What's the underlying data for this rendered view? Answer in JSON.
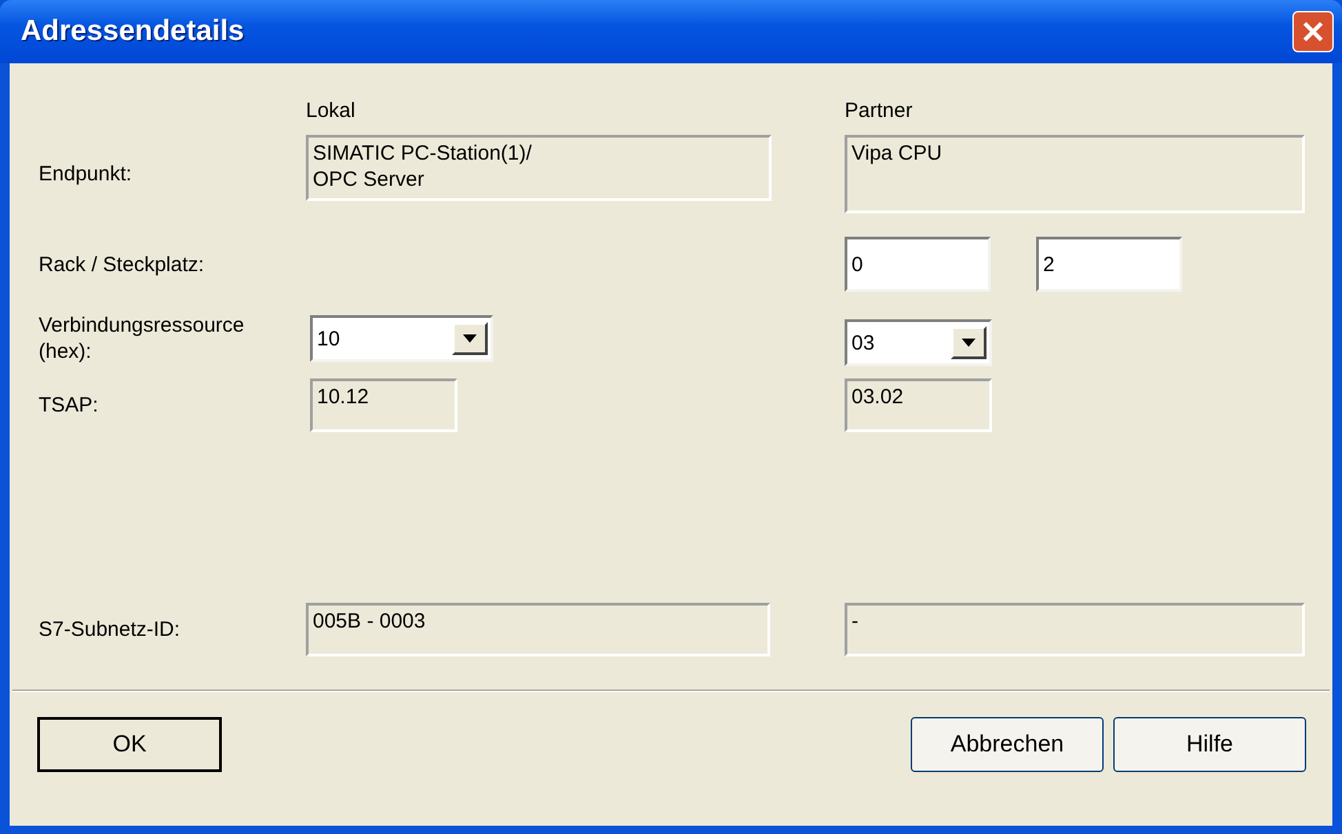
{
  "window": {
    "title": "Adressendetails"
  },
  "columns": [
    "Lokal",
    "Partner"
  ],
  "rows": [
    {
      "kind": "endpoint",
      "label": "Endpunkt:",
      "local": [
        {
          "kind": "readonly",
          "value": "SIMATIC PC-Station(1)/\nOPC Server"
        }
      ],
      "partner": [
        {
          "kind": "readonly",
          "value": "Vipa CPU"
        }
      ]
    },
    {
      "kind": "rack",
      "label": "Rack / Steckplatz:",
      "local": [],
      "partner": [
        {
          "kind": "input",
          "value": "0"
        },
        {
          "kind": "input",
          "value": "2"
        }
      ]
    },
    {
      "kind": "resource",
      "label": "Verbindungsressource (hex):",
      "local": [
        {
          "kind": "dropdown",
          "value": "10"
        }
      ],
      "partner": [
        {
          "kind": "dropdown",
          "value": "03"
        }
      ]
    },
    {
      "kind": "tsap",
      "label": "TSAP:",
      "local": [
        {
          "kind": "readonly",
          "value": "10.12"
        }
      ],
      "partner": [
        {
          "kind": "readonly",
          "value": "03.02"
        }
      ]
    },
    {
      "kind": "subnet",
      "label": "S7-Subnetz-ID:",
      "local": [
        {
          "kind": "readonly",
          "value": "005B - 0003"
        }
      ],
      "partner": [
        {
          "kind": "readonly",
          "value": "-"
        }
      ]
    }
  ],
  "buttons": [
    {
      "label": "OK",
      "default": true
    },
    {
      "label": "Abbrechen",
      "default": false
    },
    {
      "label": "Hilfe",
      "default": false
    }
  ]
}
